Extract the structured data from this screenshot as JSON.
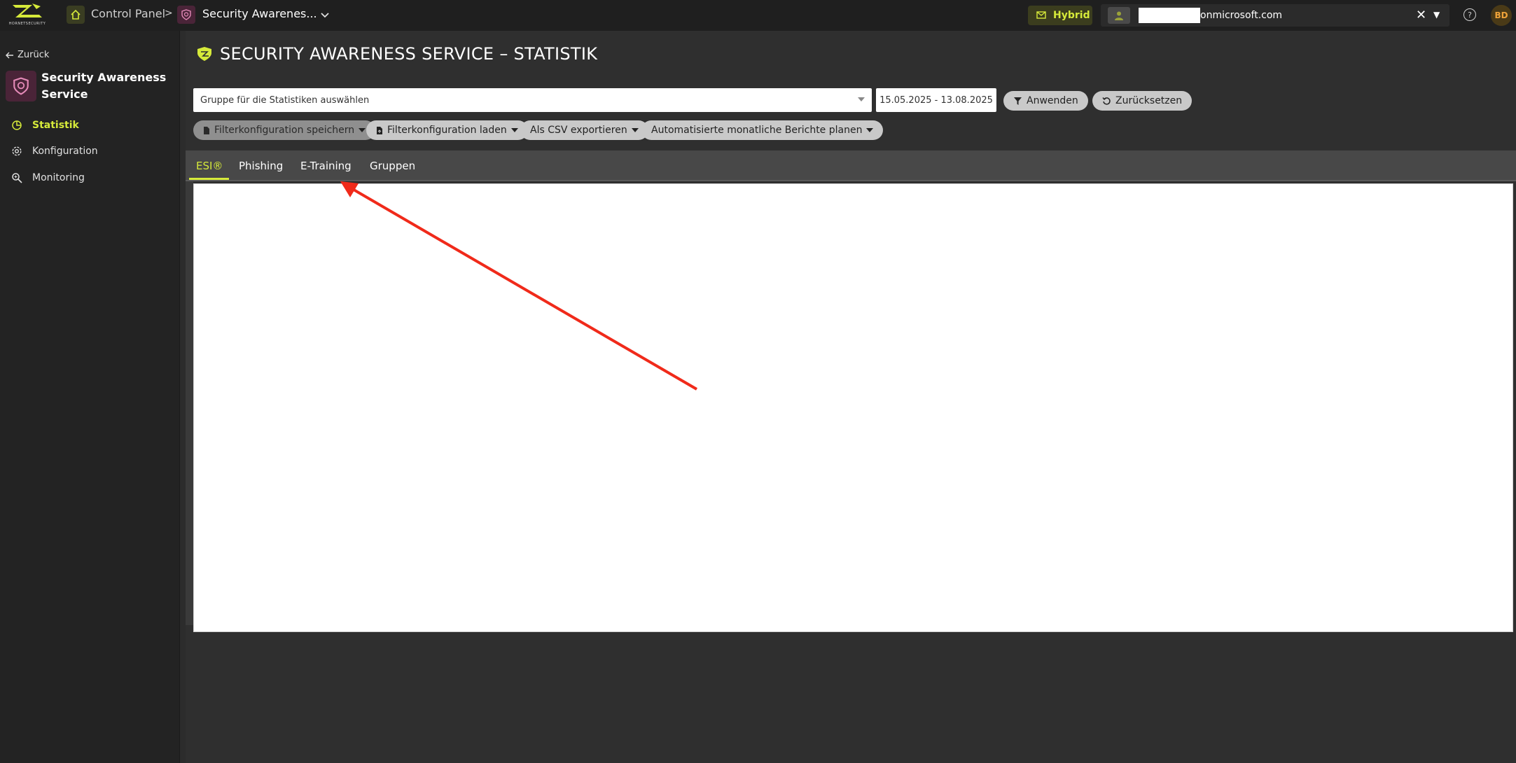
{
  "topbar": {
    "logo_text": "HORNETSECURITY",
    "breadcrumb_control_panel": "Control Panel",
    "breadcrumb_separator": ">",
    "breadcrumb_service": "Security Awarenes...",
    "hybrid_label": "Hybrid",
    "tenant_domain": "onmicrosoft.com",
    "tenant_clear": "✕",
    "help": "?",
    "user_initials": "BD"
  },
  "sidebar": {
    "back_label": "Zurück",
    "service_title": "Security Awareness Service",
    "items": [
      {
        "label": "Statistik",
        "icon": "chart-pie-icon",
        "active": true
      },
      {
        "label": "Konfiguration",
        "icon": "gear-icon",
        "active": false
      },
      {
        "label": "Monitoring",
        "icon": "magnifier-icon",
        "active": false
      }
    ]
  },
  "main": {
    "title": "SECURITY AWARENESS SERVICE – STATISTIK",
    "group_select_placeholder": "Gruppe für die Statistiken auswählen",
    "date_range": "15.05.2025 - 13.08.2025",
    "apply_label": "Anwenden",
    "reset_label": "Zurücksetzen",
    "save_filter_label": "Filterkonfiguration speichern",
    "load_filter_label": "Filterkonfiguration laden",
    "csv_export_label": "Als CSV exportieren",
    "monthly_reports_label": "Automatisierte monatliche Berichte planen",
    "tabs": [
      {
        "label": "ESI®",
        "active": true
      },
      {
        "label": "Phishing",
        "active": false
      },
      {
        "label": "E-Training",
        "active": false
      },
      {
        "label": "Gruppen",
        "active": false
      }
    ]
  },
  "annotation": {
    "arrow_color": "#f02a1a"
  },
  "colors": {
    "accent": "#d6ea3a",
    "background": "#2f2f2f",
    "sidebar": "#232323",
    "topbar": "#1f1f1f"
  }
}
